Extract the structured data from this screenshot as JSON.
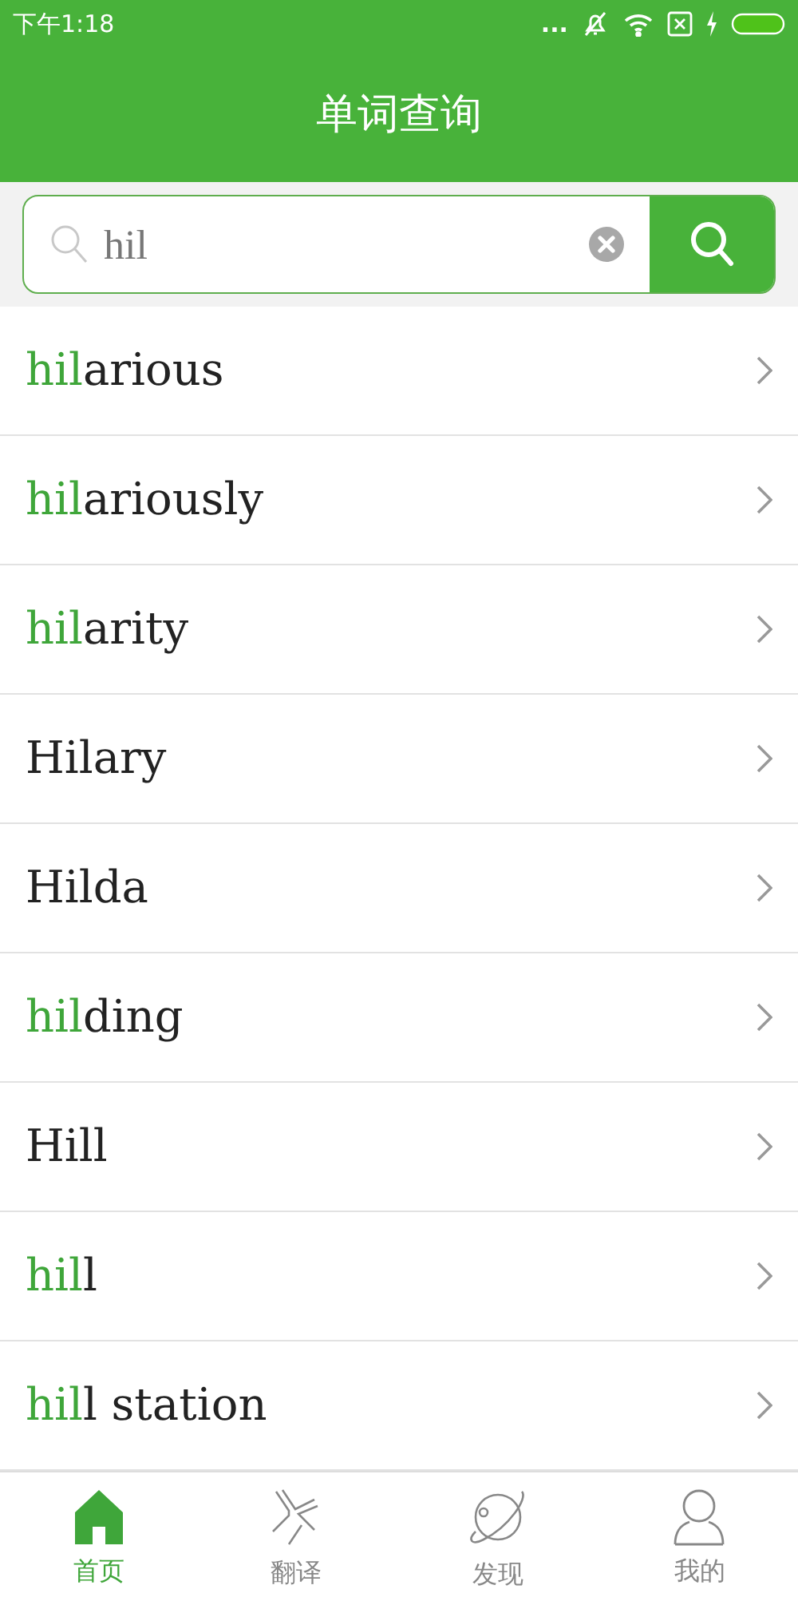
{
  "status_bar": {
    "time": "下午1:18",
    "dots": "..."
  },
  "header": {
    "title": "单词查询"
  },
  "search": {
    "value": "hil"
  },
  "results": [
    {
      "matched": "hil",
      "text": "arious"
    },
    {
      "matched": "hil",
      "text": "ariously"
    },
    {
      "matched": "hil",
      "text": "arity"
    },
    {
      "text": "Hilary"
    },
    {
      "text": "Hilda"
    },
    {
      "matched": "hil",
      "text": "ding"
    },
    {
      "text": "Hill"
    },
    {
      "matched": "hil",
      "text": "l"
    },
    {
      "matched": "hil",
      "text": "l station"
    }
  ],
  "tab_bar": [
    {
      "label": "首页",
      "kind": "home",
      "selected": true
    },
    {
      "label": "翻译",
      "kind": "translate",
      "selected": false
    },
    {
      "label": "发现",
      "kind": "discover",
      "selected": false
    },
    {
      "label": "我的",
      "kind": "profile",
      "selected": false
    }
  ]
}
